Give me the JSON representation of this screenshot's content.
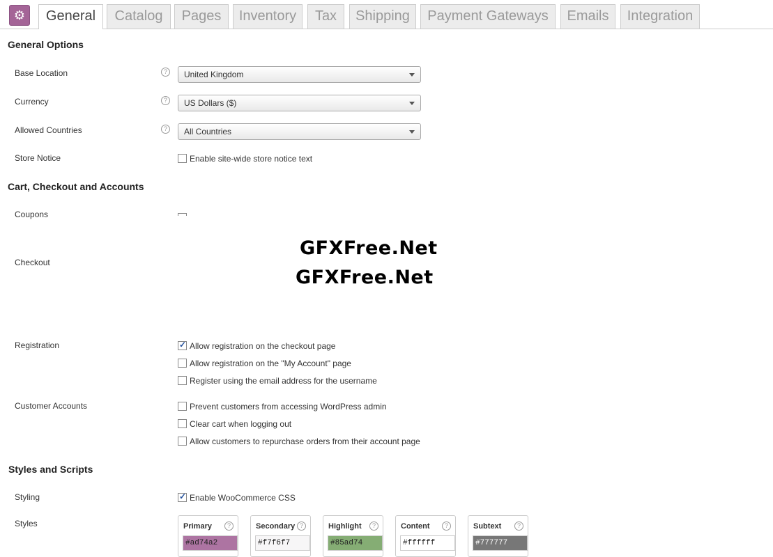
{
  "tabs": [
    {
      "label": "General"
    },
    {
      "label": "Catalog"
    },
    {
      "label": "Pages"
    },
    {
      "label": "Inventory"
    },
    {
      "label": "Tax"
    },
    {
      "label": "Shipping"
    },
    {
      "label": "Payment Gateways"
    },
    {
      "label": "Emails"
    },
    {
      "label": "Integration"
    }
  ],
  "icons": {
    "settings": "gear-icon",
    "help": "question-icon",
    "dropdown": "chevron-down-icon"
  },
  "colors": {
    "accent": "#a46497"
  },
  "general": {
    "heading": "General Options",
    "base_location": {
      "label": "Base Location",
      "value": "United Kingdom"
    },
    "currency": {
      "label": "Currency",
      "value": "US Dollars ($)"
    },
    "allowed_countries": {
      "label": "Allowed Countries",
      "value": "All Countries"
    },
    "store_notice": {
      "label": "Store Notice",
      "checkbox": "Enable site-wide store notice text"
    }
  },
  "cart": {
    "heading": "Cart, Checkout and Accounts",
    "coupons_label": "Coupons",
    "checkout_label": "Checkout",
    "registration_label": "Registration",
    "registration_options": [
      "Allow registration on the checkout page",
      "Allow registration on the \"My Account\" page",
      "Register using the email address for the username"
    ],
    "customer_accounts_label": "Customer Accounts",
    "customer_accounts_options": [
      "Prevent customers from accessing WordPress admin",
      "Clear cart when logging out",
      "Allow customers to repurchase orders from their account page"
    ]
  },
  "watermark": [
    "GFXFree.Net",
    "GFXFree.Net"
  ],
  "styles": {
    "heading": "Styles and Scripts",
    "styling_label": "Styling",
    "styling_option": "Enable WooCommerce CSS",
    "styles_label": "Styles",
    "boxes": [
      {
        "title": "Primary",
        "value": "#ad74a2"
      },
      {
        "title": "Secondary",
        "value": "#f7f6f7"
      },
      {
        "title": "Highlight",
        "value": "#85ad74"
      },
      {
        "title": "Content",
        "value": "#ffffff"
      },
      {
        "title": "Subtext",
        "value": "#777777"
      }
    ]
  }
}
